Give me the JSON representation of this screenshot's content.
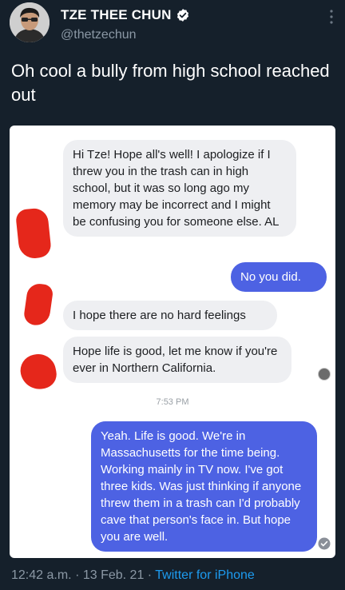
{
  "tweet": {
    "display_name": "TZE THEE CHUN",
    "handle": "@thetzechun",
    "text": "Oh cool a bully from high school reached out",
    "time": "12:42 a.m.",
    "date": "13 Feb. 21",
    "separator": "·",
    "source": "Twitter for iPhone"
  },
  "messages": {
    "m1": "Hi Tze!  Hope all's well!  I apologize if I threw you in the trash can in high school, but it was so long ago my memory may be incorrect and I might be confusing you for someone else.  AL",
    "m2": "No you did.",
    "m3": "I hope there are no hard feelings",
    "m4": "Hope life is good, let me know if you're ever in Northern California.",
    "timestamp": "7:53 PM",
    "m5": "Yeah. Life is good. We're in Massachusetts for the time being. Working mainly in TV now. I've got three kids. Was just thinking if anyone threw them in a trash can I'd probably cave that person's face in. But hope you are well."
  },
  "icons": {
    "verified": "verified-badge-icon",
    "more": "more-vertical-icon",
    "read_receipt": "check-circle-icon"
  },
  "colors": {
    "background": "#15202b",
    "link": "#1d9bf0",
    "sent_bubble": "#4d62e3",
    "received_bubble": "#eeeff2",
    "redaction": "#e5271b"
  }
}
